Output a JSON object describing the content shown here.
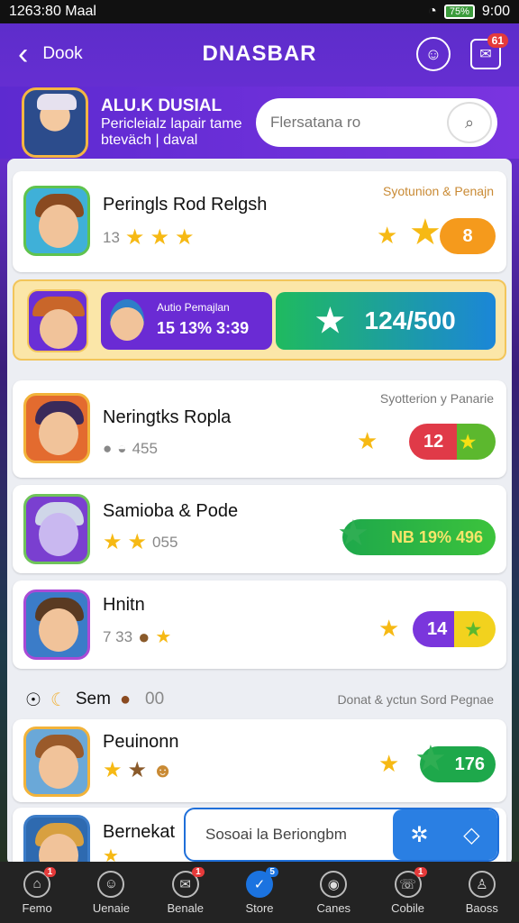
{
  "status_bar": {
    "time_left": "1263:80 Maal",
    "time_right": "9:00",
    "battery": "75%"
  },
  "header": {
    "back_label": "Dook",
    "title": "DNASBAR",
    "notification_count": "61"
  },
  "profile": {
    "name": "ALU.K DUSIAL",
    "line1": "Pericleialz lapair tame",
    "line2": "bteväch | daval",
    "search_placeholder": "Flersatana ro"
  },
  "games": [
    {
      "title": "Peringls Rod Relgsh",
      "genre": "Syotunion & Penajn",
      "meta": "13",
      "score": "8",
      "pill_color": "#f59a1c"
    },
    {
      "title": "Neringtks Ropla",
      "genre": "Syotterion y Panarie",
      "meta": "455",
      "score": "12",
      "pill_color": "#e03a48"
    },
    {
      "title": "Samioba & Pode",
      "genre": "",
      "meta": "055",
      "score": "NB 19% 496",
      "pill_color": "#1ea84b"
    },
    {
      "title": "Hnitn",
      "genre": "",
      "meta": "7 33",
      "score": "14",
      "pill_color": "#7a36dc"
    },
    {
      "title": "Peuinonn",
      "genre": "",
      "meta": "",
      "score": "176",
      "pill_color": "#1ea84b"
    },
    {
      "title": "Bernekat",
      "genre": "",
      "meta": "",
      "score": "",
      "pill_color": ""
    }
  ],
  "featured": {
    "player_label": "Autio Pemajlan",
    "player_value": "15 13% 3:39",
    "score": "124/500"
  },
  "section": {
    "title": "Sem",
    "count": "00",
    "right_label": "Donat & yctun Sord Pegnae"
  },
  "mini_search": {
    "placeholder": "Sosoai la Beriongbm"
  },
  "nav": [
    {
      "label": "Femo",
      "badge": "1",
      "icon": "home-icon"
    },
    {
      "label": "Uenaie",
      "badge": "",
      "icon": "user-icon"
    },
    {
      "label": "Benale",
      "badge": "1",
      "icon": "chat-icon"
    },
    {
      "label": "Store",
      "badge": "5",
      "icon": "store-icon"
    },
    {
      "label": "Canes",
      "badge": "",
      "icon": "games-icon"
    },
    {
      "label": "Cobile",
      "badge": "1",
      "icon": "mobile-icon"
    },
    {
      "label": "Baoss",
      "badge": "",
      "icon": "profile-icon"
    }
  ]
}
